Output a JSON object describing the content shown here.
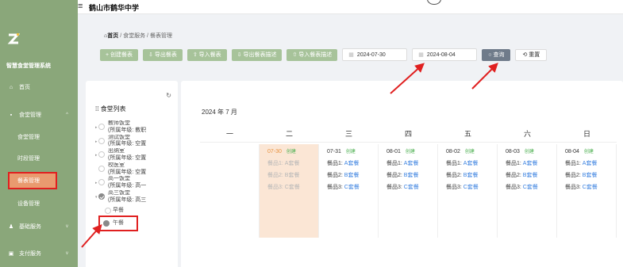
{
  "header": {
    "menu_icon": "≡",
    "school_name": "鹤山市鹤华中学"
  },
  "sidebar": {
    "system_name": "智慧食堂管理系统",
    "items": [
      {
        "icon": "home-icon",
        "glyph": "⌂",
        "label": "首页"
      },
      {
        "icon": "canteen-icon",
        "glyph": "▪",
        "label": "食堂管理",
        "arrow": "^"
      },
      {
        "label": "食堂管理"
      },
      {
        "label": "时段管理"
      },
      {
        "label": "餐表管理",
        "active": true
      },
      {
        "label": "设备管理"
      },
      {
        "icon": "user-icon",
        "glyph": "♟",
        "label": "基础服务",
        "arrow": "v"
      },
      {
        "icon": "pay-icon",
        "glyph": "▣",
        "label": "支付服务",
        "arrow": "v"
      }
    ]
  },
  "breadcrumb": {
    "home": "首页",
    "sep1": "/",
    "level1": "食堂服务",
    "sep2": "/",
    "level2": "餐表管理"
  },
  "toolbar": {
    "create": "+ 创建餐表",
    "export": "⇩ 导出餐表",
    "import": "⇧ 导入餐表",
    "export_desc": "⇩ 导出餐表描述",
    "import_desc": "⇧ 导入餐表描述",
    "date_start": "2024-07-30",
    "date_end": "2024-08-04",
    "query": "○ 查询",
    "reset": "⟲ 重置"
  },
  "canteen_list": {
    "title": "食堂列表",
    "nodes": [
      {
        "name": "教师饭堂",
        "grade": "(所属年级: 教职"
      },
      {
        "name": "测试饭堂",
        "grade": "(所属年级: 空置"
      },
      {
        "name": "出纳室",
        "grade": "(所属年级: 空置"
      },
      {
        "name": "校医室",
        "grade": "(所属年级: 空置"
      },
      {
        "name": "高一饭堂",
        "grade": "(所属年级: 高一"
      },
      {
        "name": "高三饭堂",
        "grade": "(所属年级: 高三"
      }
    ],
    "children": [
      "早餐",
      "午餐"
    ]
  },
  "calendar": {
    "month": "2024 年 7 月",
    "weekdays": [
      "一",
      "二",
      "三",
      "四",
      "五",
      "六",
      "日"
    ],
    "days": [
      {
        "date": "07-30",
        "badge": "创建",
        "meals": [
          [
            "餐品1:",
            "A套餐"
          ],
          [
            "餐品2:",
            "B套餐"
          ],
          [
            "餐品3:",
            "C套餐"
          ]
        ]
      },
      {
        "date": "07-31",
        "badge": "创建",
        "meals": [
          [
            "餐品1:",
            "A套餐"
          ],
          [
            "餐品2:",
            "B套餐"
          ],
          [
            "餐品3:",
            "C套餐"
          ]
        ]
      },
      {
        "date": "08-01",
        "badge": "创建",
        "meals": [
          [
            "餐品1:",
            "A套餐"
          ],
          [
            "餐品2:",
            "B套餐"
          ],
          [
            "餐品3:",
            "C套餐"
          ]
        ]
      },
      {
        "date": "08-02",
        "badge": "创建",
        "meals": [
          [
            "餐品1:",
            "A套餐"
          ],
          [
            "餐品2:",
            "B套餐"
          ],
          [
            "餐品3:",
            "C套餐"
          ]
        ]
      },
      {
        "date": "08-03",
        "badge": "创建",
        "meals": [
          [
            "餐品1:",
            "A套餐"
          ],
          [
            "餐品2:",
            "B套餐"
          ],
          [
            "餐品3:",
            "C套餐"
          ]
        ]
      },
      {
        "date": "08-04",
        "badge": "创建",
        "meals": [
          [
            "餐品1:",
            "A套餐"
          ],
          [
            "餐品2:",
            "B套餐"
          ],
          [
            "餐品3:",
            "C套餐"
          ]
        ]
      }
    ]
  },
  "colors": {
    "sidebar": "#8aa77a",
    "active": "#e99a6f",
    "today": "#fbe6d5",
    "link": "#3b82e0",
    "badge": "#4caf50",
    "annotation": "#e02020"
  }
}
